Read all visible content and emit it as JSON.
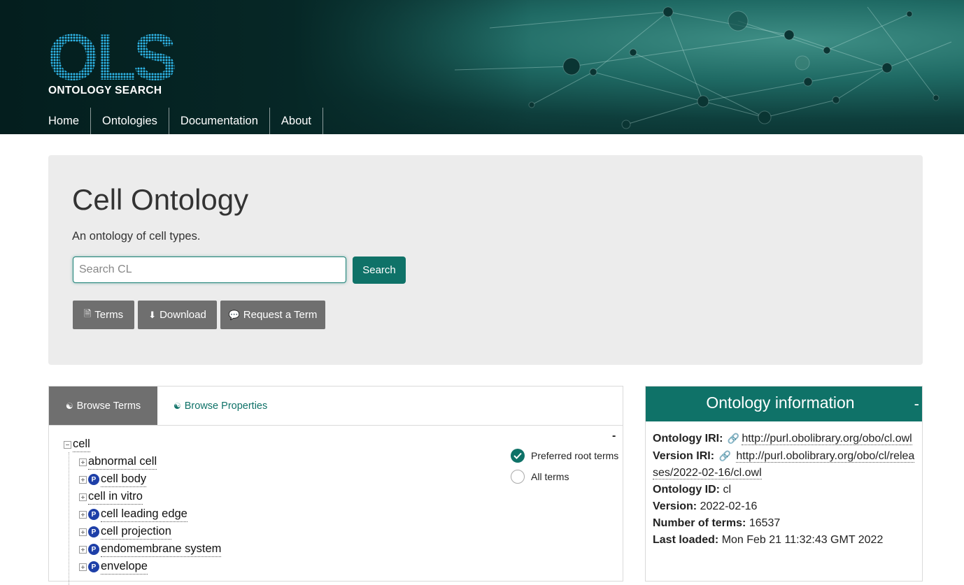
{
  "header": {
    "logo_letters": "OLS",
    "logo_sub": "ONTOLOGY SEARCH",
    "nav": [
      {
        "label": "Home"
      },
      {
        "label": "Ontologies"
      },
      {
        "label": "Documentation"
      },
      {
        "label": "About"
      }
    ]
  },
  "hero": {
    "title": "Cell Ontology",
    "description": "An ontology of cell types.",
    "search": {
      "placeholder": "Search CL",
      "button_label": "Search"
    },
    "buttons": {
      "terms": "Terms",
      "download": "Download",
      "request": "Request a Term"
    }
  },
  "browse": {
    "tabs": {
      "terms": "Browse Terms",
      "properties": "Browse Properties"
    },
    "collapse": "-",
    "root": "cell",
    "children": [
      {
        "label": "abnormal cell",
        "preferred": false
      },
      {
        "label": "cell body",
        "preferred": true,
        "badge": "P"
      },
      {
        "label": "cell in vitro",
        "preferred": false
      },
      {
        "label": "cell leading edge",
        "preferred": true,
        "badge": "P"
      },
      {
        "label": "cell projection",
        "preferred": true,
        "badge": "P"
      },
      {
        "label": "endomembrane system",
        "preferred": true,
        "badge": "P"
      },
      {
        "label": "envelope",
        "preferred": true,
        "badge": "P"
      }
    ],
    "options": {
      "preferred": "Preferred root terms",
      "all": "All terms",
      "selected": "preferred"
    }
  },
  "info": {
    "title": "Ontology information",
    "collapse": "-",
    "iri_label": "Ontology IRI:",
    "iri": "http://purl.obolibrary.org/obo/cl.owl",
    "version_iri_label": "Version IRI:",
    "version_iri": "http://purl.obolibrary.org/obo/cl/releases/2022-02-16/cl.owl",
    "id_label": "Ontology ID:",
    "id": "cl",
    "version_label": "Version:",
    "version": "2022-02-16",
    "terms_label": "Number of terms:",
    "terms": "16537",
    "loaded_label": "Last loaded:",
    "loaded": "Mon Feb 21 11:32:43 GMT 2022"
  },
  "colors": {
    "accent": "#0f7268",
    "button_gray": "#6f6f6f",
    "badge_blue": "#1e3fa8",
    "panel_bg": "#ececec"
  }
}
